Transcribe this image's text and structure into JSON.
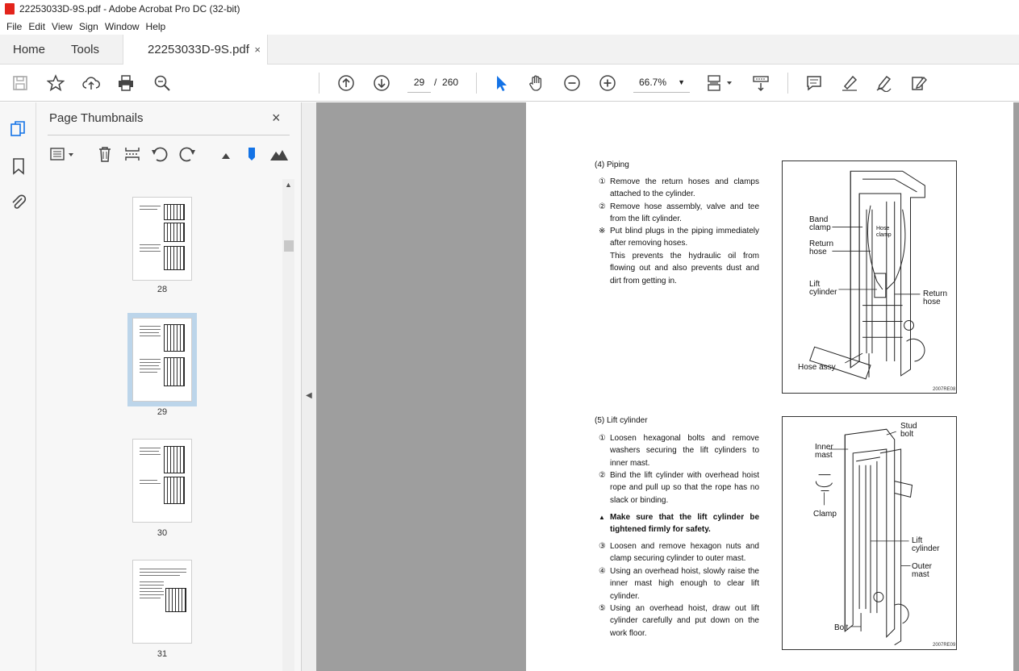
{
  "window": {
    "title": "22253033D-9S.pdf - Adobe Acrobat Pro DC (32-bit)"
  },
  "menu": [
    "File",
    "Edit",
    "View",
    "Sign",
    "Window",
    "Help"
  ],
  "tabs": {
    "home": "Home",
    "tools": "Tools",
    "document": "22253033D-9S.pdf",
    "close_glyph": "×"
  },
  "navigation": {
    "current_page": "29",
    "separator": "/",
    "total_pages": "260",
    "zoom": "66.7%"
  },
  "icons": {
    "toolbar": [
      "save-icon",
      "star-icon",
      "cloud-upload-icon",
      "print-icon",
      "zoom-search-icon",
      "page-up-icon",
      "page-down-icon",
      "select-arrow-icon",
      "hand-icon",
      "zoom-out-icon",
      "zoom-in-icon",
      "page-layout-icon",
      "scroll-mode-icon",
      "comment-icon",
      "highlight-pen-icon",
      "sign-icon",
      "fill-sign-icon"
    ],
    "rail": [
      "page-thumbnails-icon",
      "bookmark-icon",
      "attachment-icon"
    ]
  },
  "sidebar": {
    "title": "Page Thumbnails",
    "close_glyph": "×",
    "thumbnails": [
      {
        "label": "28",
        "selected": false
      },
      {
        "label": "29",
        "selected": true
      },
      {
        "label": "30",
        "selected": false
      },
      {
        "label": "31",
        "selected": false
      }
    ]
  },
  "colors": {
    "accent": "#1473e6",
    "selected_thumb": "#bcd5ea",
    "canvas_gray": "#9e9e9e"
  },
  "document": {
    "sections": [
      {
        "heading": "(4) Piping",
        "items": [
          {
            "mark": "①",
            "text": "Remove the return hoses and clamps attached to the cylinder."
          },
          {
            "mark": "②",
            "text": "Remove hose assembly, valve and tee from the lift cylinder."
          },
          {
            "mark": "※",
            "text": "Put blind plugs in the piping immediately after removing hoses."
          },
          {
            "mark": "",
            "text": "This prevents the hydraulic oil from flowing out and also prevents dust and dirt from getting in."
          }
        ],
        "figure": {
          "labels": [
            "Band clamp",
            "Return hose",
            "Hose clamp",
            "Lift cylinder",
            "Return hose",
            "Hose assy"
          ],
          "code": "2007RE08"
        }
      },
      {
        "heading": "(5) Lift cylinder",
        "items": [
          {
            "mark": "①",
            "text": "Loosen hexagonal bolts and remove washers securing the lift cylinders to inner mast."
          },
          {
            "mark": "②",
            "text": "Bind the lift cylinder with overhead hoist rope and pull up so that the rope has no slack or binding."
          },
          {
            "mark": "▲",
            "text": "Make sure that the lift cylinder be tightened firmly for safety."
          },
          {
            "mark": "③",
            "text": "Loosen and remove hexagon nuts and clamp securing cylinder to outer mast."
          },
          {
            "mark": "④",
            "text": "Using an overhead hoist, slowly raise the inner mast high enough to clear lift cylinder."
          },
          {
            "mark": "⑤",
            "text": "Using an overhead hoist, draw out lift cylinder carefully and put down on the work floor."
          }
        ],
        "figure": {
          "labels": [
            "Stud bolt",
            "Inner mast",
            "Clamp",
            "Lift cylinder",
            "Outer mast",
            "Bolt"
          ],
          "code": "2007RE09"
        }
      }
    ]
  }
}
